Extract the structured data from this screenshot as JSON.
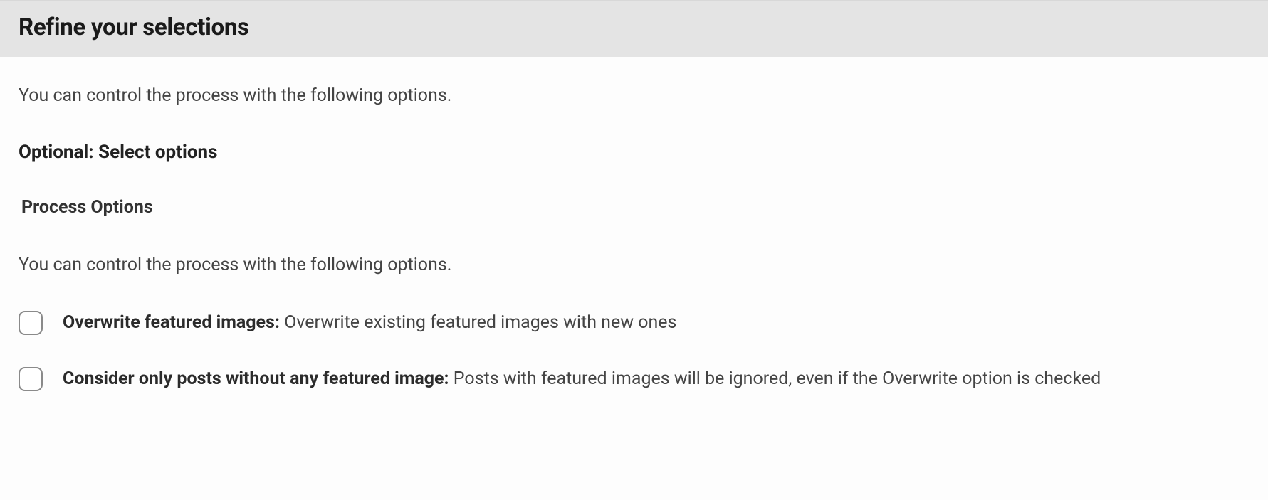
{
  "header": {
    "title": "Refine your selections"
  },
  "content": {
    "intro": "You can control the process with the following options.",
    "subheading": "Optional: Select options",
    "section_label": "Process Options",
    "section_intro": "You can control the process with the following options.",
    "options": [
      {
        "label": "Overwrite featured images:",
        "description": " Overwrite existing featured images with new ones"
      },
      {
        "label": "Consider only posts without any featured image:",
        "description": " Posts with featured images will be ignored, even if the Overwrite option is checked"
      }
    ]
  }
}
